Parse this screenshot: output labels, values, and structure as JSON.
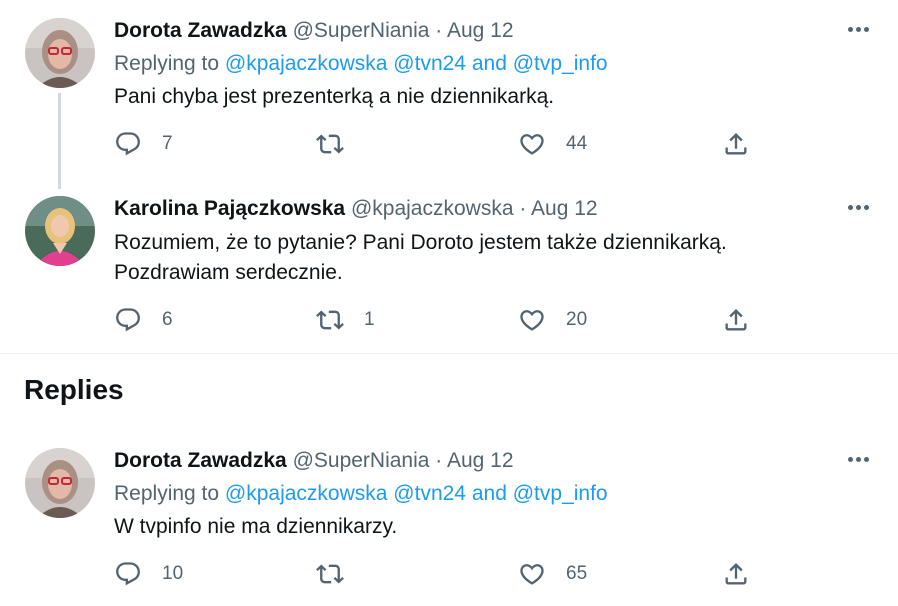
{
  "tweets": [
    {
      "author": "Dorota Zawadzka",
      "handle": "@SuperNiania",
      "sep": "·",
      "date": "Aug 12",
      "replying_prefix": "Replying to",
      "mentions": [
        "@kpajaczkowska",
        "@tvn24",
        "@tvp_info"
      ],
      "and_word": "and",
      "text": "Pani chyba jest prezenterką a nie dziennikarką.",
      "text2": "",
      "reply_count": "7",
      "retweet_count": "",
      "like_count": "44"
    },
    {
      "author": "Karolina Pajączkowska",
      "handle": "@kpajaczkowska",
      "sep": "·",
      "date": "Aug 12",
      "text": "Rozumiem, że to pytanie? Pani Doroto jestem także dziennikarką.",
      "text2": "Pozdrawiam serdecznie.",
      "reply_count": "6",
      "retweet_count": "1",
      "like_count": "20"
    },
    {
      "author": "Dorota Zawadzka",
      "handle": "@SuperNiania",
      "sep": "·",
      "date": "Aug 12",
      "replying_prefix": "Replying to",
      "mentions": [
        "@kpajaczkowska",
        "@tvn24",
        "@tvp_info"
      ],
      "and_word": "and",
      "text": "W tvpinfo nie ma dziennikarzy.",
      "text2": "",
      "reply_count": "10",
      "retweet_count": "",
      "like_count": "65"
    }
  ],
  "section_title": "Replies",
  "icons": {
    "reply": "reply-icon",
    "retweet": "retweet-icon",
    "like": "like-icon",
    "share": "share-icon",
    "more": "more-icon"
  },
  "colors": {
    "link": "#1d9bf0",
    "secondary": "#536471",
    "text": "#0f1419",
    "thread_line": "#cfd9de"
  }
}
